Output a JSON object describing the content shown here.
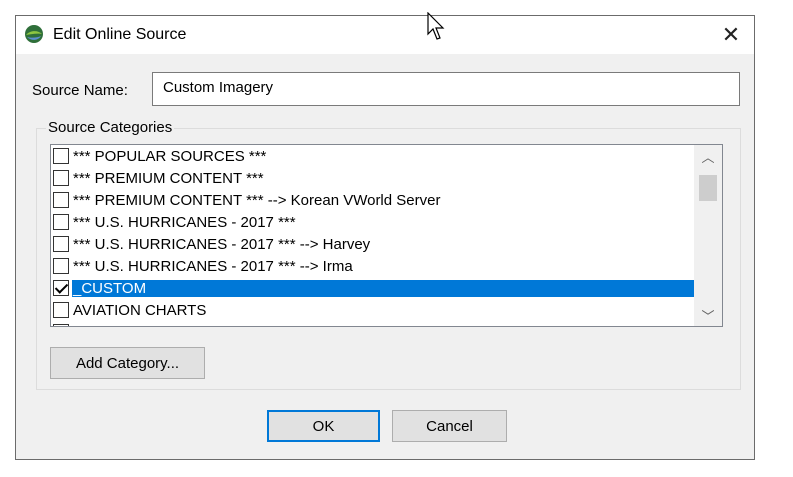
{
  "window": {
    "title": "Edit Online Source",
    "close_glyph": "✕"
  },
  "source_name": {
    "label": "Source Name:",
    "value": "Custom Imagery"
  },
  "categories": {
    "group_label": "Source Categories",
    "items": [
      {
        "label": "*** POPULAR SOURCES ***",
        "checked": false,
        "selected": false
      },
      {
        "label": "*** PREMIUM CONTENT ***",
        "checked": false,
        "selected": false
      },
      {
        "label": "*** PREMIUM CONTENT *** --> Korean VWorld Server",
        "checked": false,
        "selected": false
      },
      {
        "label": "*** U.S. HURRICANES - 2017 ***",
        "checked": false,
        "selected": false
      },
      {
        "label": "*** U.S. HURRICANES - 2017 *** --> Harvey",
        "checked": false,
        "selected": false
      },
      {
        "label": "*** U.S. HURRICANES - 2017 *** --> Irma",
        "checked": false,
        "selected": false
      },
      {
        "label": "_CUSTOM",
        "checked": true,
        "selected": true
      },
      {
        "label": "AVIATION CHARTS",
        "checked": false,
        "selected": false
      },
      {
        "label": "",
        "checked": false,
        "selected": false
      }
    ],
    "scroll_up_glyph": "︿",
    "scroll_down_glyph": "﹀"
  },
  "buttons": {
    "add_category": "Add Category...",
    "ok": "OK",
    "cancel": "Cancel"
  },
  "colors": {
    "selection": "#0078d7",
    "dialog_bg": "#f0f0f0",
    "accent": "#0078d7"
  }
}
